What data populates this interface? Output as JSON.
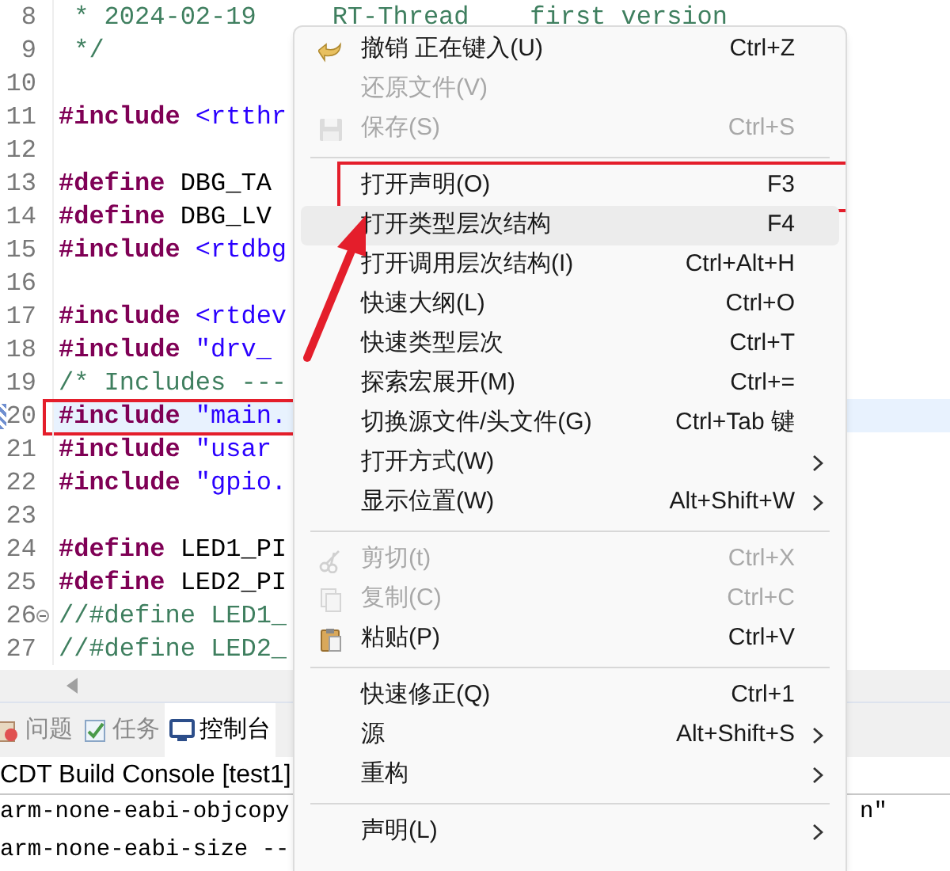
{
  "editor": {
    "lines": [
      {
        "number": "8",
        "segments": [
          {
            "kind": "comment",
            "text": " * 2024-02-19     RT-Thread    first version"
          }
        ]
      },
      {
        "number": "9",
        "segments": [
          {
            "kind": "comment",
            "text": " */"
          }
        ]
      },
      {
        "number": "10"
      },
      {
        "number": "11",
        "segments": [
          {
            "kind": "keyword",
            "text": "#include"
          },
          {
            "kind": "string",
            "text": " <rtthr"
          }
        ]
      },
      {
        "number": "12"
      },
      {
        "number": "13",
        "segments": [
          {
            "kind": "keyword",
            "text": "#define"
          },
          {
            "kind": "plain",
            "text": " DBG_TA"
          }
        ]
      },
      {
        "number": "14",
        "segments": [
          {
            "kind": "keyword",
            "text": "#define"
          },
          {
            "kind": "plain",
            "text": " DBG_LV"
          }
        ]
      },
      {
        "number": "15",
        "segments": [
          {
            "kind": "keyword",
            "text": "#include"
          },
          {
            "kind": "string",
            "text": " <rtdbg"
          }
        ]
      },
      {
        "number": "16"
      },
      {
        "number": "17",
        "segments": [
          {
            "kind": "keyword",
            "text": "#include"
          },
          {
            "kind": "string",
            "text": " <rtdev"
          }
        ]
      },
      {
        "number": "18",
        "segments": [
          {
            "kind": "keyword",
            "text": "#include"
          },
          {
            "kind": "string",
            "text": " \"drv_"
          }
        ]
      },
      {
        "number": "19",
        "segments": [
          {
            "kind": "comment",
            "text": "/* Includes ---"
          }
        ]
      },
      {
        "number": "20",
        "current": true,
        "highlighted": true,
        "segments": [
          {
            "kind": "keyword",
            "text": "#include"
          },
          {
            "kind": "string",
            "text": " \"main."
          }
        ]
      },
      {
        "number": "21",
        "segments": [
          {
            "kind": "keyword",
            "text": "#include"
          },
          {
            "kind": "string",
            "text": " \"usar"
          }
        ]
      },
      {
        "number": "22",
        "segments": [
          {
            "kind": "keyword",
            "text": "#include"
          },
          {
            "kind": "string",
            "text": " \"gpio."
          }
        ]
      },
      {
        "number": "23"
      },
      {
        "number": "24",
        "segments": [
          {
            "kind": "keyword",
            "text": "#define"
          },
          {
            "kind": "plain",
            "text": " LED1_PI"
          }
        ]
      },
      {
        "number": "25",
        "segments": [
          {
            "kind": "keyword",
            "text": "#define"
          },
          {
            "kind": "plain",
            "text": " LED2_PI"
          }
        ]
      },
      {
        "number": "26",
        "fold_marker": true,
        "segments": [
          {
            "kind": "comment",
            "text": "//#define LED1_"
          }
        ]
      },
      {
        "number": "27",
        "segments": [
          {
            "kind": "comment",
            "text": "//#define LED2_"
          }
        ]
      }
    ]
  },
  "bottom_tabs": [
    {
      "label": "问题",
      "selected": false
    },
    {
      "label": "任务",
      "selected": false
    },
    {
      "label": "控制台",
      "selected": true
    }
  ],
  "console": {
    "title": "CDT Build Console [test1]",
    "lines": [
      {
        "text": "arm-none-eabi-objcopy",
        "tail": "n\""
      },
      {
        "text": "arm-none-eabi-size --"
      }
    ]
  },
  "context_menu": {
    "items": [
      {
        "kind": "item",
        "label": "撤销 正在键入(U)",
        "shortcut": "Ctrl+Z",
        "disabled": false
      },
      {
        "kind": "item",
        "label": "还原文件(V)",
        "disabled": true
      },
      {
        "kind": "item",
        "label": "保存(S)",
        "shortcut": "Ctrl+S",
        "disabled": true
      },
      {
        "kind": "separator"
      },
      {
        "kind": "item",
        "label": "打开声明(O)",
        "shortcut": "F3",
        "disabled": false,
        "highlighted": true
      },
      {
        "kind": "item",
        "label": "打开类型层次结构",
        "shortcut": "F4",
        "disabled": false,
        "hovered": true
      },
      {
        "kind": "item",
        "label": "打开调用层次结构(I)",
        "shortcut": "Ctrl+Alt+H",
        "disabled": false
      },
      {
        "kind": "item",
        "label": "快速大纲(L)",
        "shortcut": "Ctrl+O",
        "disabled": false
      },
      {
        "kind": "item",
        "label": "快速类型层次",
        "shortcut": "Ctrl+T",
        "disabled": false
      },
      {
        "kind": "item",
        "label": "探索宏展开(M)",
        "shortcut": "Ctrl+=",
        "disabled": false
      },
      {
        "kind": "item",
        "label": "切换源文件/头文件(G)",
        "shortcut": "Ctrl+Tab 键",
        "disabled": false
      },
      {
        "kind": "item",
        "label": "打开方式(W)",
        "disabled": false,
        "submenu": true
      },
      {
        "kind": "item",
        "label": "显示位置(W)",
        "shortcut": "Alt+Shift+W",
        "disabled": false,
        "submenu": true
      },
      {
        "kind": "separator"
      },
      {
        "kind": "item",
        "label": "剪切(t)",
        "shortcut": "Ctrl+X",
        "disabled": true
      },
      {
        "kind": "item",
        "label": "复制(C)",
        "shortcut": "Ctrl+C",
        "disabled": true
      },
      {
        "kind": "item",
        "label": "粘贴(P)",
        "shortcut": "Ctrl+V",
        "disabled": false
      },
      {
        "kind": "separator"
      },
      {
        "kind": "item",
        "label": "快速修正(Q)",
        "shortcut": "Ctrl+1",
        "disabled": false
      },
      {
        "kind": "item",
        "label": "源",
        "shortcut": "Alt+Shift+S",
        "disabled": false,
        "submenu": true
      },
      {
        "kind": "item",
        "label": "重构",
        "disabled": false,
        "submenu": true
      },
      {
        "kind": "separator"
      },
      {
        "kind": "item",
        "label": "声明(L)",
        "disabled": false,
        "submenu": true
      }
    ]
  }
}
